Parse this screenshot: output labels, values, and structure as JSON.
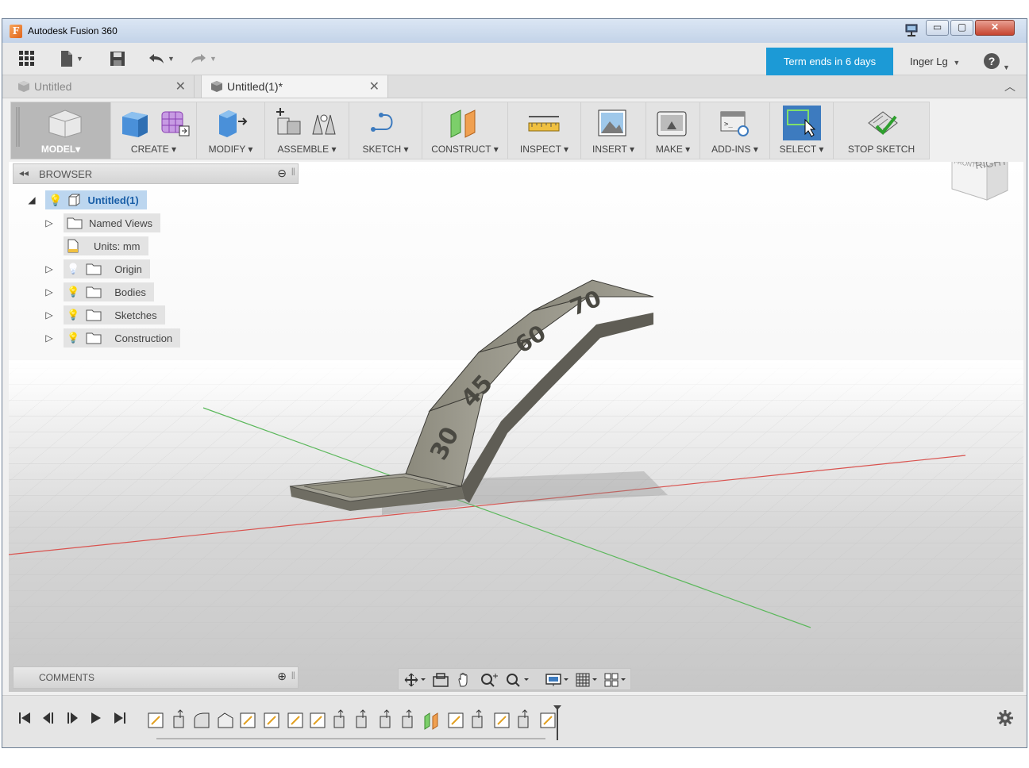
{
  "window": {
    "title": "Autodesk Fusion 360",
    "logo_letter": "F",
    "controls": {
      "minimize": "▭",
      "maximize": "▢",
      "close": "✕"
    }
  },
  "quick_access": {
    "term_notice": "Term ends in 6 days",
    "user": "Inger Lg",
    "help": "?"
  },
  "tabs": [
    {
      "label": "Untitled",
      "active": false
    },
    {
      "label": "Untitled(1)*",
      "active": true
    }
  ],
  "toolbar": {
    "workspace": "MODEL",
    "groups": [
      "CREATE",
      "MODIFY",
      "ASSEMBLE",
      "SKETCH",
      "CONSTRUCT",
      "INSPECT",
      "INSERT",
      "MAKE",
      "ADD-INS",
      "SELECT",
      "STOP SKETCH"
    ]
  },
  "viewcube": {
    "face": "RIGHT",
    "side": "FRONT"
  },
  "browser": {
    "title": "BROWSER",
    "root": "Untitled(1)",
    "items": [
      {
        "label": "Named Views",
        "bulb": false
      },
      {
        "label": "Units: mm",
        "bulb": false
      },
      {
        "label": "Origin",
        "bulb": true
      },
      {
        "label": "Bodies",
        "bulb": true
      },
      {
        "label": "Sketches",
        "bulb": true
      },
      {
        "label": "Construction",
        "bulb": true
      }
    ]
  },
  "model_labels": [
    "30",
    "45",
    "60",
    "70"
  ],
  "comments": {
    "title": "COMMENTS"
  },
  "colors": {
    "accent": "#1c9ad6",
    "select_active": "#3d7bbf",
    "axis_x": "#d9534f",
    "axis_z": "#5cb85c",
    "model": "#8e8c80"
  }
}
